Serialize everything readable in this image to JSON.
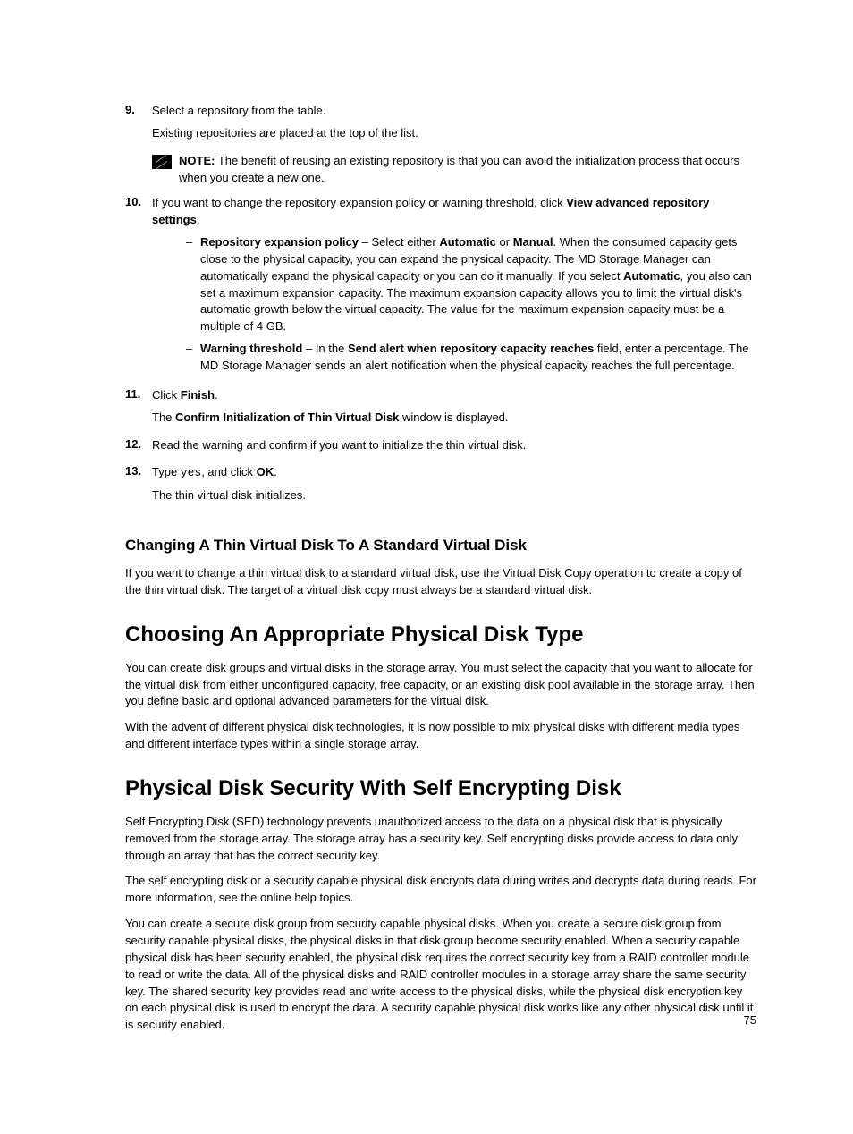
{
  "steps": {
    "s9": {
      "num": "9.",
      "l1": "Select a repository from the table.",
      "l2": "Existing repositories are placed at the top of the list."
    },
    "note1": {
      "label": "NOTE:",
      "text": " The benefit of reusing an existing repository is that you can avoid the initialization process that occurs when you create a new one."
    },
    "s10": {
      "num": "10.",
      "pre": "If you want to change the repository expansion policy or warning threshold, click ",
      "bold": "View advanced repository settings",
      "post": "."
    },
    "bullets": {
      "b1": {
        "t1": "Repository expansion policy",
        "t2": " – Select either ",
        "t3": "Automatic",
        "t4": " or ",
        "t5": "Manual",
        "t6": ". When the consumed capacity gets close to the physical capacity, you can expand the physical capacity. The MD Storage Manager can automatically expand the physical capacity or you can do it manually. If you select ",
        "t7": "Automatic",
        "t8": ", you also can set a maximum expansion capacity. The maximum expansion capacity allows you to limit the virtual disk's automatic growth below the virtual capacity. The value for the maximum expansion capacity must be a multiple of 4 GB."
      },
      "b2": {
        "t1": "Warning threshold",
        "t2": " – In the ",
        "t3": "Send alert when repository capacity reaches",
        "t4": " field, enter a percentage. The MD Storage Manager sends an alert notification when the physical capacity reaches the full percentage."
      }
    },
    "s11": {
      "num": "11.",
      "pre": "Click ",
      "bold": "Finish",
      "post": ".",
      "sub_pre": "The ",
      "sub_bold": "Confirm Initialization of Thin Virtual Disk",
      "sub_post": " window is displayed."
    },
    "s12": {
      "num": "12.",
      "text": "Read the warning and confirm if you want to initialize the thin virtual disk."
    },
    "s13": {
      "num": "13.",
      "pre": "Type ",
      "mono": "yes",
      "mid": ", and click ",
      "bold": "OK",
      "post": ".",
      "sub": "The thin virtual disk initializes."
    }
  },
  "h3_1": "Changing A Thin Virtual Disk To A Standard Virtual Disk",
  "p1": "If you want to change a thin virtual disk to a standard virtual disk, use the Virtual Disk Copy operation to create a copy of the thin virtual disk. The target of a virtual disk copy must always be a standard virtual disk.",
  "h2_1": "Choosing An Appropriate Physical Disk Type",
  "p2": "You can create disk groups and virtual disks in the storage array. You must select the capacity that you want to allocate for the virtual disk from either unconfigured capacity, free capacity, or an existing disk pool available in the storage array. Then you define basic and optional advanced parameters for the virtual disk.",
  "p3": "With the advent of different physical disk technologies, it is now possible to mix physical disks with different media types and different interface types within a single storage array.",
  "h2_2": "Physical Disk Security With Self Encrypting Disk",
  "p4": "Self Encrypting Disk (SED) technology prevents unauthorized access to the data on a physical disk that is physically removed from the storage array. The storage array has a security key. Self encrypting disks provide access to data only through an array that has the correct security key.",
  "p5": "The self encrypting disk or a security capable physical disk encrypts data during writes and decrypts data during reads. For more information, see the online help topics.",
  "p6": "You can create a secure disk group from security capable physical disks. When you create a secure disk group from security capable physical disks, the physical disks in that disk group become security enabled. When a security capable physical disk has been security enabled, the physical disk requires the correct security key from a RAID controller module to read or write the data. All of the physical disks and RAID controller modules in a storage array share the same security key. The shared security key provides read and write access to the physical disks, while the physical disk encryption key on each physical disk is used to encrypt the data. A security capable physical disk works like any other physical disk until it is security enabled.",
  "page_number": "75"
}
